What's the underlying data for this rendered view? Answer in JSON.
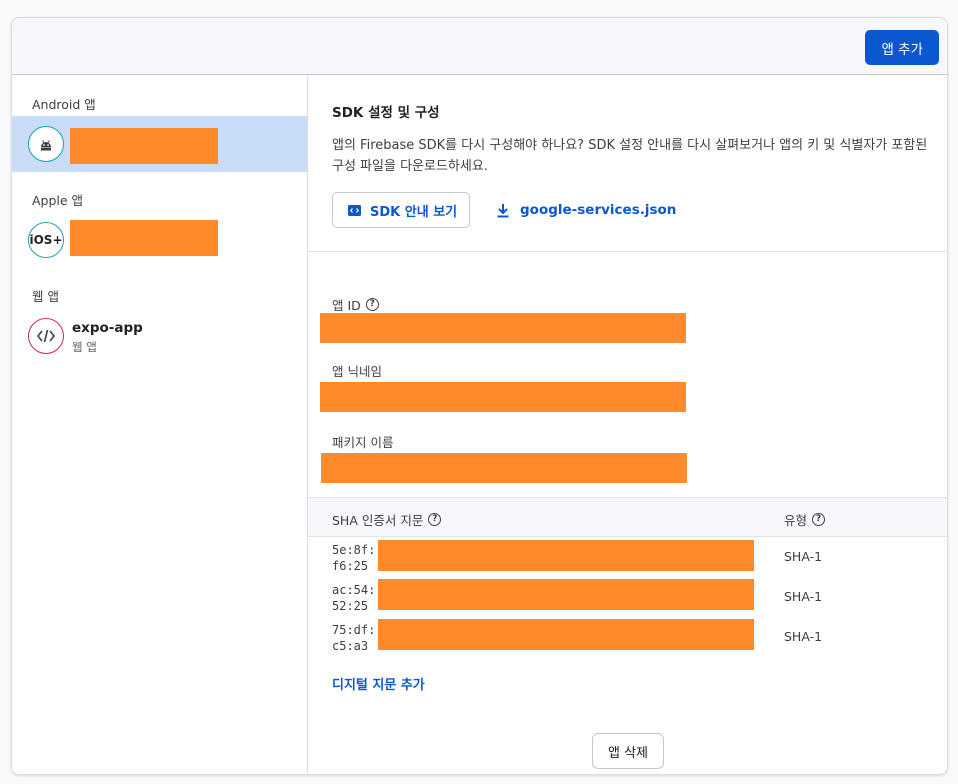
{
  "header": {
    "add_app_label": "앱 추가"
  },
  "sidebar": {
    "groups": [
      {
        "label": "Android 앱",
        "icon": "android-icon"
      },
      {
        "label": "Apple 앱",
        "icon": "ios-icon",
        "icon_text": "iOS+"
      },
      {
        "label": "웹 앱",
        "icon": "code-icon"
      }
    ],
    "web_app": {
      "name": "expo-app",
      "sub": "웹 앱"
    }
  },
  "sdk": {
    "title": "SDK 설정 및 구성",
    "description": "앱의 Firebase SDK를 다시 구성해야 하나요? SDK 설정 안내를 다시 살펴보거나 앱의 키 및 식별자가 포함된 구성 파일을 다운로드하세요.",
    "guide_button": "SDK 안내 보기",
    "download_link": "google-services.json"
  },
  "fields": {
    "app_id_label": "앱 ID",
    "nickname_label": "앱 닉네임",
    "package_label": "패키지 이름"
  },
  "sha": {
    "col_fingerprint": "SHA 인증서 지문",
    "col_type": "유형",
    "rows": [
      {
        "prefix": "5e:8f:",
        "suffix": "f6:25",
        "type": "SHA-1"
      },
      {
        "prefix": "ac:54:",
        "suffix": "52:25",
        "type": "SHA-1"
      },
      {
        "prefix": "75:df:",
        "suffix": "c5:a3",
        "type": "SHA-1"
      }
    ],
    "add_label": "디지털 지문 추가"
  },
  "actions": {
    "delete_label": "앱 삭제"
  },
  "colors": {
    "accent": "#0b57d0",
    "selected_bg": "#c9dcf8",
    "redaction": "#ff8a2b"
  }
}
